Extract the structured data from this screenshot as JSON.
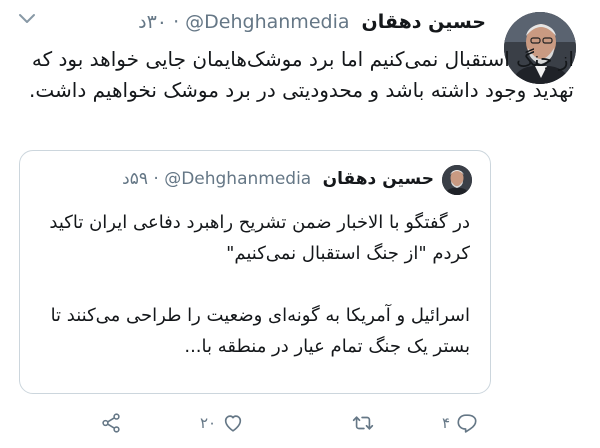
{
  "tweet": {
    "author_name": "حسین دهقان",
    "handle": "@Dehghanmedia",
    "separator": "·",
    "time": "۳۰د",
    "text": "از جنگ استقبال نمی‌کنیم اما برد موشک‌هایمان جایی خواهد بود که تهدید وجود داشته باشد و محدودیتی در برد موشک نخواهیم داشت.",
    "icons": {
      "menu": "chevron-down-icon",
      "avatar": "profile-photo"
    }
  },
  "quoted_tweet": {
    "author_name": "حسین دهقان",
    "handle": "@Dehghanmedia",
    "separator": "·",
    "time": "۵۹د",
    "paragraph_1": "در گفتگو با الاخبار ضمن تشریح راهبرد دفاعی ایران تاکید کردم \"از جنگ استقبال نمی‌کنیم\"",
    "paragraph_2": "اسرائیل و آمریکا به گونه‌ای وضعیت را طراحی می‌کنند تا بستر یک جنگ تمام عیار در منطقه با..."
  },
  "actions": {
    "reply_count": "۴",
    "retweet_count": "",
    "like_count": "۲۰",
    "icons": [
      "reply-icon",
      "retweet-icon",
      "like-icon",
      "share-icon"
    ]
  },
  "colors": {
    "text": "#14171a",
    "secondary": "#657786",
    "border": "#ccd6dd"
  }
}
